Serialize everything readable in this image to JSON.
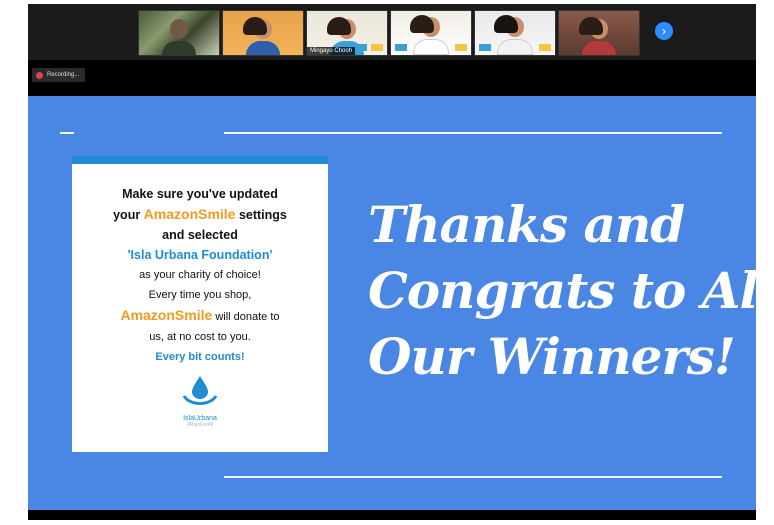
{
  "participants": [
    {
      "id": "p1",
      "name": ""
    },
    {
      "id": "p2",
      "name": ""
    },
    {
      "id": "p3",
      "name": "Mingayu Chooh"
    },
    {
      "id": "p4",
      "name": ""
    },
    {
      "id": "p5",
      "name": ""
    },
    {
      "id": "p6",
      "name": ""
    }
  ],
  "controls": {
    "next_icon": "chevron-right-icon",
    "recording_label": "Recording..."
  },
  "slide": {
    "card": {
      "line1": "Make sure you've updated",
      "line2_pre": "your ",
      "line2_brand": "AmazonSmile",
      "line2_post": " settings",
      "line3": "and selected",
      "line4": "'Isla Urbana Foundation'",
      "line5": "as your charity of choice!",
      "line6": "Every time you shop,",
      "line7_brand": "AmazonSmile",
      "line7_post": " will donate to",
      "line8": "us, at no cost to you.",
      "line9": "Every bit counts!",
      "logo_name": "IslaUrbana",
      "logo_tag": "#RainForAll"
    },
    "headline": [
      "Thanks and",
      "Congrats to All",
      "Our Winners!"
    ]
  },
  "colors": {
    "slide_bg": "#4a86e3",
    "accent_orange": "#f19a23",
    "accent_blue": "#1f8cd4",
    "recording_red": "#e0424f"
  }
}
